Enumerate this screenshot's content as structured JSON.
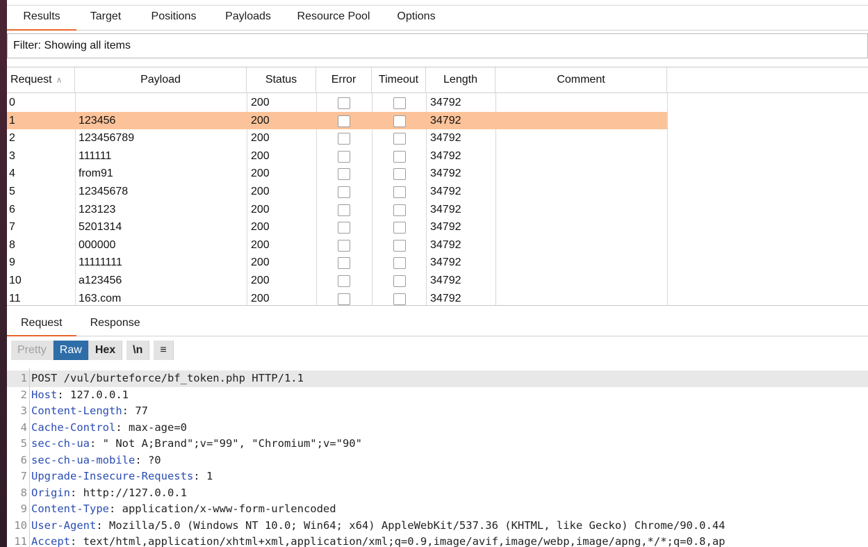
{
  "tabs": [
    "Results",
    "Target",
    "Positions",
    "Payloads",
    "Resource Pool",
    "Options"
  ],
  "filter": "Filter: Showing all items",
  "columns": [
    "Request",
    "Payload",
    "Status",
    "Error",
    "Timeout",
    "Length",
    "Comment"
  ],
  "rows": [
    {
      "request": "0",
      "payload": "",
      "status": "200",
      "length": "34792"
    },
    {
      "request": "1",
      "payload": "123456",
      "status": "200",
      "length": "34792",
      "selected": true
    },
    {
      "request": "2",
      "payload": "123456789",
      "status": "200",
      "length": "34792"
    },
    {
      "request": "3",
      "payload": "111111",
      "status": "200",
      "length": "34792"
    },
    {
      "request": "4",
      "payload": "from91",
      "status": "200",
      "length": "34792"
    },
    {
      "request": "5",
      "payload": "12345678",
      "status": "200",
      "length": "34792"
    },
    {
      "request": "6",
      "payload": "123123",
      "status": "200",
      "length": "34792"
    },
    {
      "request": "7",
      "payload": "5201314",
      "status": "200",
      "length": "34792"
    },
    {
      "request": "8",
      "payload": "000000",
      "status": "200",
      "length": "34792"
    },
    {
      "request": "9",
      "payload": "11111111",
      "status": "200",
      "length": "34792"
    },
    {
      "request": "10",
      "payload": "a123456",
      "status": "200",
      "length": "34792"
    },
    {
      "request": "11",
      "payload": "163.com",
      "status": "200",
      "length": "34792"
    }
  ],
  "req_tabs": [
    "Request",
    "Response"
  ],
  "toolbar": {
    "pretty": "Pretty",
    "raw": "Raw",
    "hex": "Hex",
    "newline": "\\n",
    "menu": "≡"
  },
  "lines": [
    {
      "n": "1",
      "key": "",
      "rest": "POST /vul/burteforce/bf_token.php HTTP/1.1"
    },
    {
      "n": "2",
      "key": "Host",
      "rest": ": 127.0.0.1"
    },
    {
      "n": "3",
      "key": "Content-Length",
      "rest": ": 77"
    },
    {
      "n": "4",
      "key": "Cache-Control",
      "rest": ": max-age=0"
    },
    {
      "n": "5",
      "key": "sec-ch-ua",
      "rest": ": \" Not A;Brand\";v=\"99\", \"Chromium\";v=\"90\""
    },
    {
      "n": "6",
      "key": "sec-ch-ua-mobile",
      "rest": ": ?0"
    },
    {
      "n": "7",
      "key": "Upgrade-Insecure-Requests",
      "rest": ": 1"
    },
    {
      "n": "8",
      "key": "Origin",
      "rest": ": http://127.0.0.1"
    },
    {
      "n": "9",
      "key": "Content-Type",
      "rest": ": application/x-www-form-urlencoded"
    },
    {
      "n": "10",
      "key": "User-Agent",
      "rest": ": Mozilla/5.0 (Windows NT 10.0; Win64; x64) AppleWebKit/537.36 (KHTML, like Gecko) Chrome/90.0.44"
    },
    {
      "n": "11",
      "key": "Accept",
      "rest": ": text/html,application/xhtml+xml,application/xml;q=0.9,image/avif,image/webp,image/apng,*/*;q=0.8,ap"
    }
  ]
}
